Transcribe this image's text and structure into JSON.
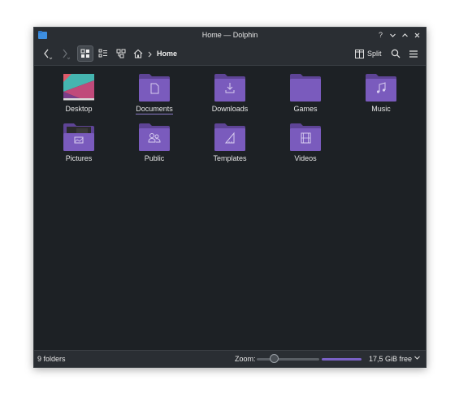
{
  "window": {
    "title": "Home — Dolphin"
  },
  "toolbar": {
    "breadcrumb_current": "Home",
    "split_label": "Split"
  },
  "items": [
    {
      "label": "Desktop",
      "icon": "desktop-folder-icon"
    },
    {
      "label": "Documents",
      "icon": "documents-folder-icon"
    },
    {
      "label": "Downloads",
      "icon": "downloads-folder-icon"
    },
    {
      "label": "Games",
      "icon": "games-folder-icon"
    },
    {
      "label": "Music",
      "icon": "music-folder-icon"
    },
    {
      "label": "Pictures",
      "icon": "pictures-folder-icon"
    },
    {
      "label": "Public",
      "icon": "public-folder-icon"
    },
    {
      "label": "Templates",
      "icon": "templates-folder-icon"
    },
    {
      "label": "Videos",
      "icon": "videos-folder-icon"
    }
  ],
  "statusbar": {
    "folder_count": "9 folders",
    "zoom_label": "Zoom:",
    "zoom_level": 0.28,
    "used_space_fraction": 1.0,
    "free_space": "17,5 GiB free"
  },
  "colors": {
    "background": "#1d2125",
    "panel": "#2a2e33",
    "folder": "#7a5bbd",
    "folder_dark": "#5e4496",
    "accent": "#7a62c6"
  }
}
